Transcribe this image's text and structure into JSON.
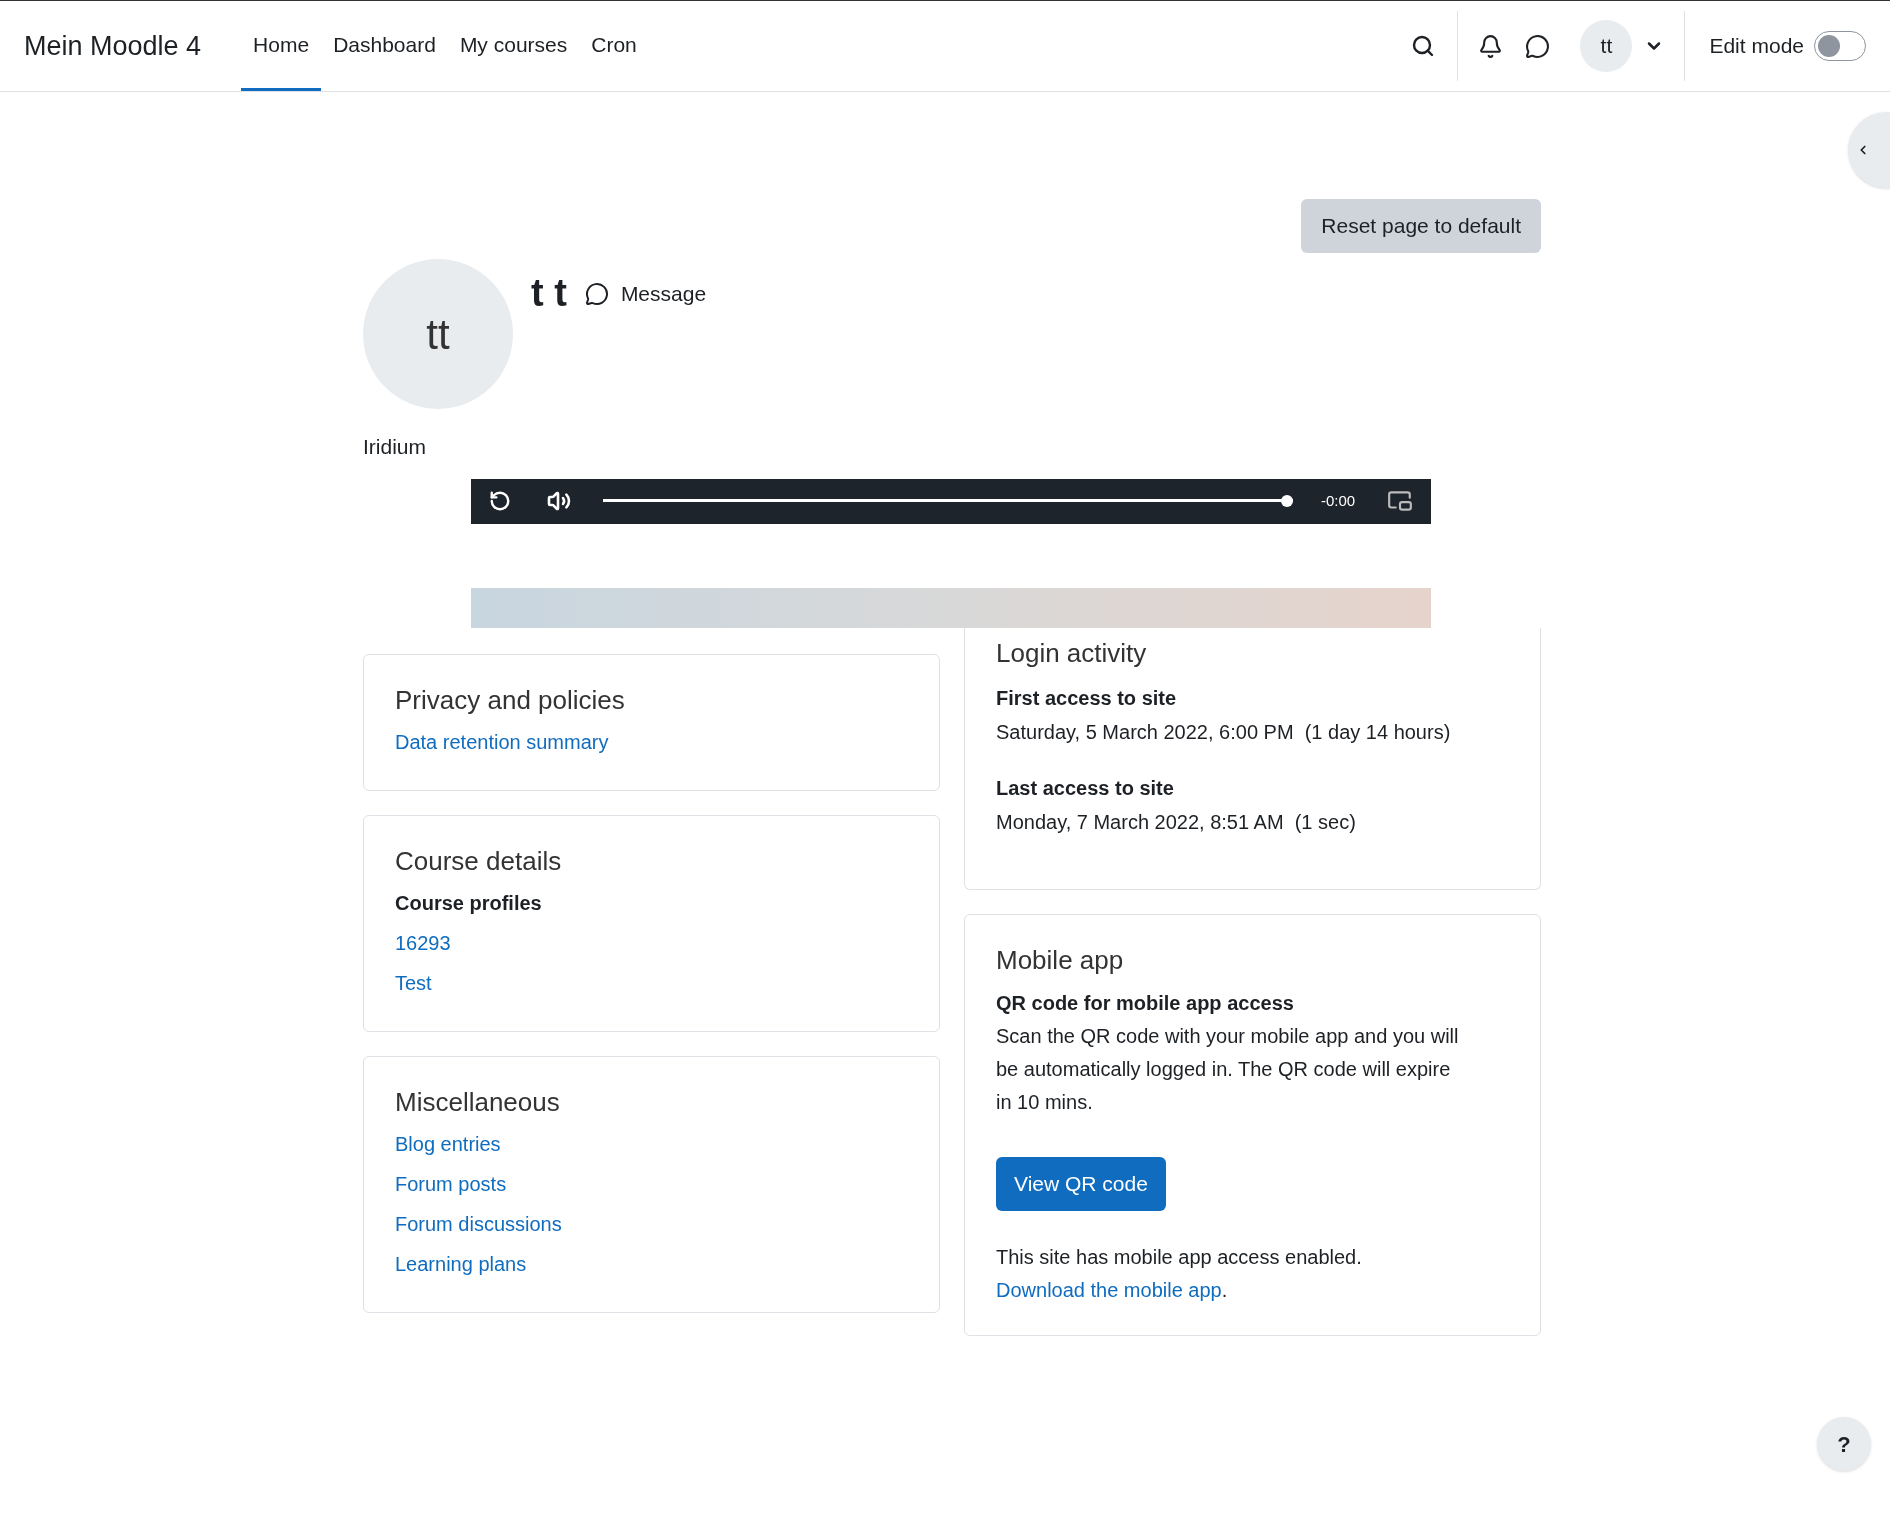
{
  "navbar": {
    "site_name": "Mein Moodle 4",
    "items": [
      {
        "label": "Home",
        "selected": true
      },
      {
        "label": "Dashboard",
        "selected": false
      },
      {
        "label": "My courses",
        "selected": false
      },
      {
        "label": "Cron",
        "selected": false
      }
    ],
    "user_initials": "tt",
    "edit_mode": {
      "label": "Edit mode",
      "on": false
    }
  },
  "reset_button": "Reset page to default",
  "profile": {
    "initials": "tt",
    "name": "t t",
    "message_link": "Message",
    "description": "Iridium"
  },
  "media_player": {
    "time": "-0:00",
    "level": 1
  },
  "left_cards": [
    {
      "title": "Privacy and policies",
      "items": [
        {
          "kind": "link",
          "text": "Data retention summary"
        }
      ]
    },
    {
      "title": "Course details",
      "items": [
        {
          "kind": "heading",
          "text": "Course profiles"
        },
        {
          "kind": "link",
          "text": "16293"
        },
        {
          "kind": "link",
          "text": "Test"
        }
      ]
    },
    {
      "title": "Miscellaneous",
      "items": [
        {
          "kind": "link",
          "text": "Blog entries"
        },
        {
          "kind": "link",
          "text": "Forum posts"
        },
        {
          "kind": "link",
          "text": "Forum discussions"
        },
        {
          "kind": "link",
          "text": "Learning plans"
        }
      ]
    }
  ],
  "login_activity": {
    "title": "Login activity",
    "entries": [
      {
        "heading": "First access to site",
        "value": "Saturday, 5 March 2022, 6:00 PM  (1 day 14 hours)"
      },
      {
        "heading": "Last access to site",
        "value": "Monday, 7 March 2022, 8:51 AM  (1 sec)"
      }
    ]
  },
  "mobile_app": {
    "title": "Mobile app",
    "heading": "QR code for mobile app access",
    "text": "Scan the QR code with your mobile app and you will be automatically logged in. The QR code will expire in 10 mins.",
    "button": "View QR code",
    "note": "This site has mobile app access enabled.",
    "link": "Download the mobile app",
    "link_suffix": "."
  },
  "help_button": "?"
}
